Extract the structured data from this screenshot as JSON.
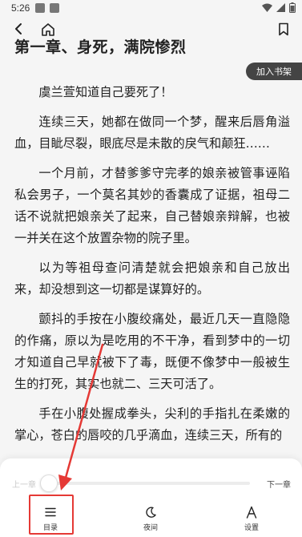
{
  "status": {
    "time": "5:26"
  },
  "chapter": {
    "title": "第一章、身死，满院惨烈"
  },
  "add_shelf_label": "加入书架",
  "content": {
    "paragraphs": [
      "虞兰萱知道自己要死了！",
      "连续三天，她都在做同一个梦，醒来后唇角溢血，目眦尽裂，眼底尽是未散的戾气和颠狂……",
      "一个月前，才替爹爹守完孝的娘亲被管事诬陷私会男子，一个莫名其妙的香囊成了证据，祖母二话不说就把娘亲关了起来，自己替娘亲辩解，也被一并关在这个放置杂物的院子里。",
      "以为等祖母查问清楚就会把娘亲和自己放出来，却没想到这一切都是谋算好的。",
      "颤抖的手按在小腹绞痛处，最近几天一直隐隐的作痛，原以为是吃用的不干净，看到梦中的一切才知道自己早就被下了毒，既便不像梦中一般被生生的打死，其实也就二、三天可活了。",
      "手在小腹处握成拳头，尖利的手指扎在柔嫩的掌心，苍白的唇咬的几乎滴血，连续三天，所有的"
    ]
  },
  "bottom_panel": {
    "prev_chapter": "上一章",
    "next_chapter": "下一章",
    "progress_fraction": 0.0,
    "nav": {
      "toc": "目录",
      "night": "夜间",
      "settings": "设置"
    }
  },
  "colors": {
    "highlight": "#e53935",
    "background": "#f5f5f5",
    "button_dark": "#444444"
  }
}
